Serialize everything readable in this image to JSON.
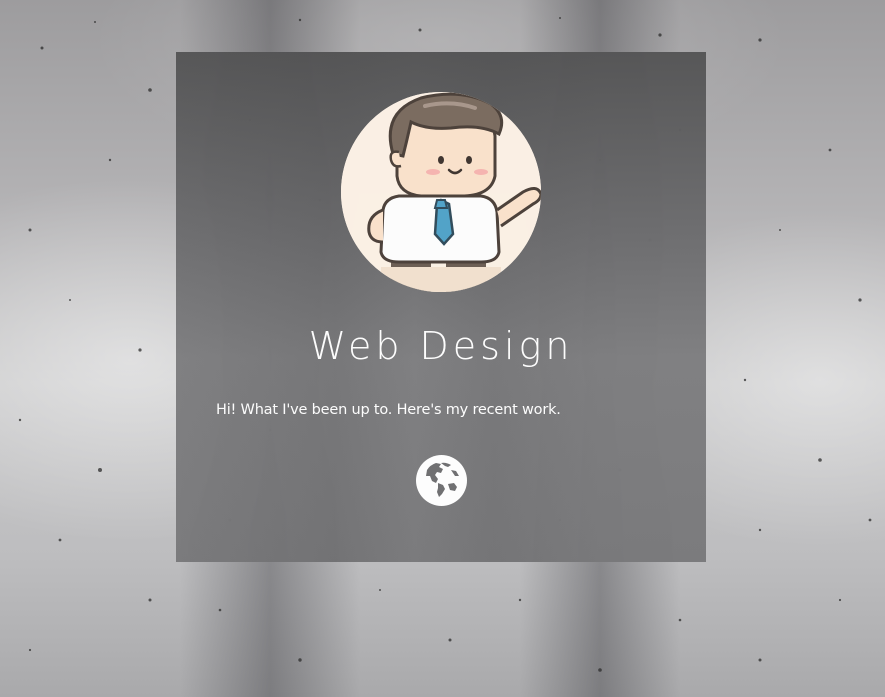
{
  "card": {
    "title": "Web Design",
    "description": "Hi! What I've been up to. Here's my recent work."
  },
  "icons": {
    "avatar": "cartoon-businessman-avatar",
    "link": "globe-icon"
  },
  "colors": {
    "card_background": "#6e6e70",
    "text": "#ffffff",
    "tie": "#4fa3c9"
  }
}
